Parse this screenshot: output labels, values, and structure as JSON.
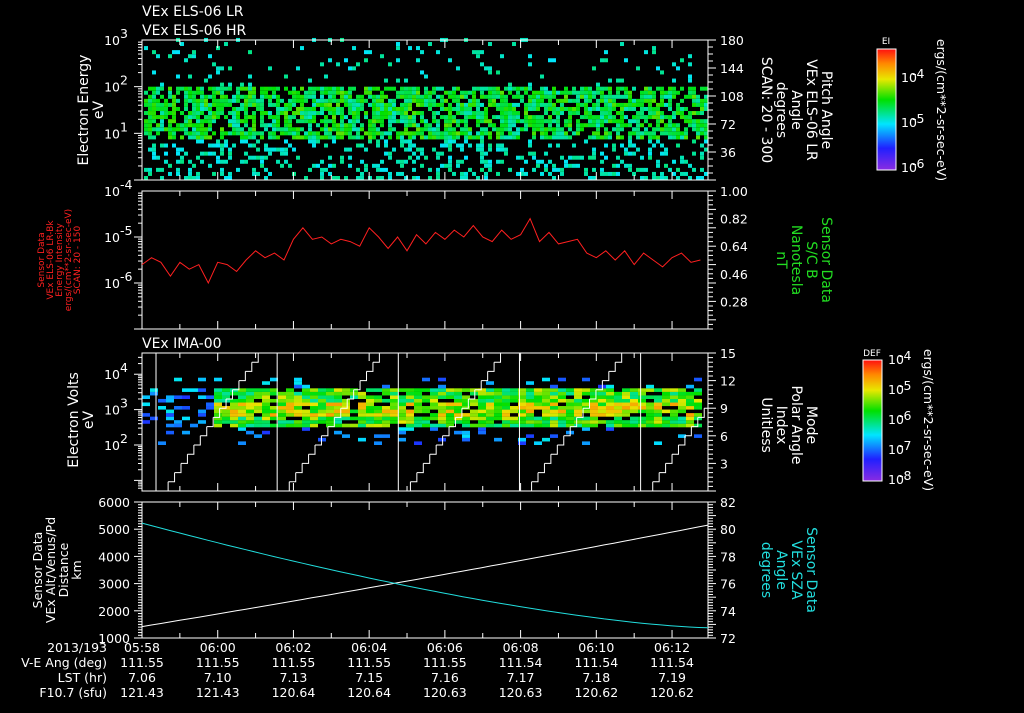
{
  "titles": {
    "els_lr": "VEx ELS-06 LR",
    "els_hr": "VEx ELS-06 HR",
    "ima": "VEx IMA-00"
  },
  "time_axis": {
    "date": "2013/193",
    "start": "05:58",
    "ticks": [
      "05:58",
      "06:00",
      "06:02",
      "06:04",
      "06:06",
      "06:08",
      "06:10",
      "06:12"
    ],
    "range_minutes": [
      0,
      14.95
    ]
  },
  "footer": {
    "rows": [
      {
        "label": "V-E Ang (deg)",
        "values": [
          "111.55",
          "111.55",
          "111.55",
          "111.55",
          "111.55",
          "111.54",
          "111.54",
          "111.54"
        ]
      },
      {
        "label": "LST (hr)",
        "values": [
          "7.06",
          "7.10",
          "7.13",
          "7.15",
          "7.16",
          "7.17",
          "7.18",
          "7.19"
        ]
      },
      {
        "label": "F10.7 (sfu)",
        "values": [
          "121.43",
          "121.43",
          "120.64",
          "120.64",
          "120.63",
          "120.63",
          "120.62",
          "120.62"
        ]
      }
    ]
  },
  "colors": {
    "red": "#ff2020",
    "green": "#22dd22",
    "cyan": "#22dddd",
    "white": "#ffffff"
  },
  "chart_data": [
    {
      "type": "heatmap",
      "name": "ELS electron spectrogram",
      "ylabel": [
        "Electron Energy",
        "eV"
      ],
      "yscale": "log",
      "ylim_log10": [
        0,
        3
      ],
      "yticks": [
        {
          "exp": "1",
          "v": 1
        },
        {
          "exp": "2",
          "v": 2
        },
        {
          "exp": "3",
          "v": 3
        }
      ],
      "right_axis": {
        "label": [
          "Pitch Angle",
          "VEx ELS-06 LR",
          "Angle",
          "degrees",
          "SCAN: 20 - 300"
        ],
        "ticks": [
          "180",
          "144",
          "108",
          "72",
          "36"
        ],
        "ylim": [
          0,
          180
        ]
      },
      "colorbar": {
        "title": "EI",
        "ticks": [
          {
            "exp": "-4"
          },
          {
            "exp": "-5"
          },
          {
            "exp": "-6"
          }
        ],
        "units": "ergs/(cm**2-sr-sec-eV)"
      },
      "core_band_log10": [
        0.8,
        2.0
      ],
      "sparse_band_log10": [
        0,
        3
      ]
    },
    {
      "type": "line",
      "name": "ELS energy intensity",
      "ylabel": [
        "Sensor Data",
        "VEx ELS-06 LR-Bk",
        "Energy Intensity",
        "ergs/(cm**2-sr-sec-eV)",
        "SCAN: 20 - 150"
      ],
      "yscale": "log",
      "ylim_log10": [
        -7,
        -4
      ],
      "yticks": [
        {
          "exp": "-4",
          "v": -4
        },
        {
          "exp": "-5",
          "v": -5
        },
        {
          "exp": "-6",
          "v": -6
        }
      ],
      "right_axis": {
        "label": [
          "Sensor Data",
          "S/C B",
          "Nanotesla",
          "nT"
        ],
        "ticks": [
          "1.00",
          "0.82",
          "0.64",
          "0.46",
          "0.28"
        ]
      },
      "x_minutes_step": 0.25,
      "values_log10": [
        -5.6,
        -5.45,
        -5.55,
        -5.85,
        -5.55,
        -5.7,
        -5.6,
        -6.0,
        -5.55,
        -5.6,
        -5.75,
        -5.5,
        -5.3,
        -5.45,
        -5.35,
        -5.5,
        -5.05,
        -4.8,
        -5.05,
        -5.0,
        -5.15,
        -5.05,
        -5.1,
        -5.2,
        -4.8,
        -5.0,
        -5.25,
        -5.0,
        -5.3,
        -4.95,
        -5.15,
        -4.9,
        -5.05,
        -4.85,
        -5.0,
        -4.75,
        -5.0,
        -5.1,
        -4.85,
        -5.05,
        -4.95,
        -4.6,
        -5.1,
        -4.9,
        -5.15,
        -5.1,
        -5.05,
        -5.35,
        -5.45,
        -5.3,
        -5.5,
        -5.3,
        -5.6,
        -5.35,
        -5.5,
        -5.65,
        -5.45,
        -5.35,
        -5.55,
        -5.5
      ]
    },
    {
      "type": "heatmap",
      "name": "IMA ion spectrogram",
      "ylabel": [
        "Electron Volts",
        "eV"
      ],
      "yscale": "log",
      "ylim_log10": [
        0.7,
        4.6
      ],
      "yticks": [
        {
          "exp": "2",
          "v": 2
        },
        {
          "exp": "3",
          "v": 3
        },
        {
          "exp": "4",
          "v": 4
        }
      ],
      "right_axis": {
        "label": [
          "Mode",
          "Polar Angle",
          "Index",
          "Unitless"
        ],
        "ticks": [
          "15",
          "12",
          "9",
          "6",
          "3"
        ],
        "ylim": [
          0,
          15
        ]
      },
      "mode_sawtooth": {
        "period_minutes": 3.2,
        "first_reset_minutes": 0.37,
        "max": 15
      },
      "colorbar": {
        "title": "DEF",
        "ticks": [
          {
            "exp": "-4"
          },
          {
            "exp": "-5"
          },
          {
            "exp": "-6"
          },
          {
            "exp": "-7"
          },
          {
            "exp": "-8"
          }
        ],
        "units": "ergs/(cm**2-sr-sec-eV)"
      },
      "core_band_log10": [
        2.4,
        3.6
      ]
    },
    {
      "type": "line",
      "name": "Altitude and SZA",
      "ylabel": [
        "Sensor Data",
        "VEx Alt/Venus/Pd",
        "Distance",
        "km"
      ],
      "ylim": [
        1000,
        6000
      ],
      "yticks": [
        "6000",
        "5000",
        "4000",
        "3000",
        "2000",
        "1000"
      ],
      "series": [
        {
          "name": "Altitude (km)",
          "color": "white",
          "start": 1420,
          "end": 5150
        },
        {
          "name": "SZA (deg)",
          "color": "cyan",
          "start": 80.45,
          "end": 72.75
        }
      ],
      "right_axis": {
        "label": [
          "Sensor Data",
          "VEx SZA",
          "Angle",
          "degrees"
        ],
        "ticks": [
          "82",
          "80",
          "78",
          "76",
          "74",
          "72"
        ],
        "ylim": [
          72,
          82
        ]
      }
    }
  ]
}
